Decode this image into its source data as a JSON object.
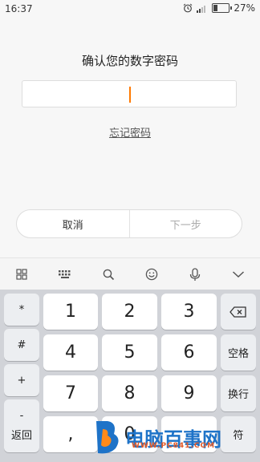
{
  "status_bar": {
    "time": "16:37",
    "battery": "27%",
    "battery_level": 0.27
  },
  "dialog": {
    "title": "确认您的数字密码",
    "forgot": "忘记密码",
    "cancel": "取消",
    "next": "下一步"
  },
  "keyboard": {
    "left_keys": [
      "*",
      "#",
      "+",
      "-"
    ],
    "digits": [
      "1",
      "2",
      "3",
      "4",
      "5",
      "6",
      "7",
      "8",
      "9"
    ],
    "bottom": {
      "back": "返回",
      "comma": ",",
      "zero": "0",
      "done": "符"
    },
    "space": "空格",
    "enter": "换行"
  },
  "watermark": {
    "text": "电脑百事网",
    "sub": "WWW.PC841.COM"
  },
  "colors": {
    "accent": "#ff7a00",
    "brand": "#1e73c8"
  }
}
